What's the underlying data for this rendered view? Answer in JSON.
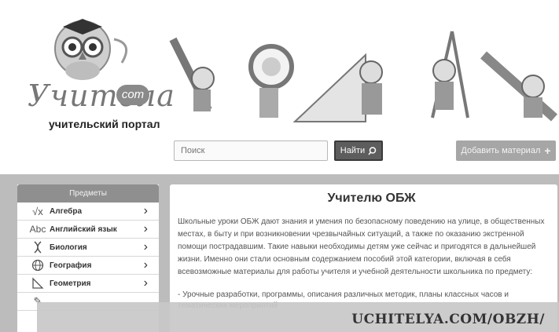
{
  "logo": {
    "name": "Учитела",
    "com": "com",
    "subtitle": "учительский портал"
  },
  "search": {
    "placeholder": "Поиск",
    "button_label": "Найти"
  },
  "add_material": {
    "label": "Добавить материал"
  },
  "sidebar": {
    "title": "Предметы",
    "items": [
      {
        "label": "Алгебра",
        "icon": "sqrt-icon"
      },
      {
        "label": "Английский язык",
        "icon": "abc-icon"
      },
      {
        "label": "Биология",
        "icon": "dna-icon"
      },
      {
        "label": "География",
        "icon": "globe-icon"
      },
      {
        "label": "Геометрия",
        "icon": "triangle-ruler-icon"
      }
    ]
  },
  "content": {
    "title": "Учителю ОБЖ",
    "paragraph": "Школьные уроки ОБЖ дают знания и умения по безопасному поведению на улице, в общественных местах, в быту и при возникновении чрезвычайных ситуаций, а также по оказанию экстренной помощи пострадавшим. Такие навыки необходимы детям уже сейчас и пригодятся в дальнейшей жизни. Именно они стали основным содержанием пособий этой категории, включая в себя всевозможные материалы для работы учителя и учебной деятельности школьника по предмету:",
    "list_item": "- Урочные разработки, программы, описания различных методик, планы классных часов и тематических мероприятий"
  },
  "caption": {
    "text": "UCHITELYA.COM/OBZH/"
  },
  "colors": {
    "band": "#bcbcbc",
    "sidebar_head": "#8f8f8f",
    "search_button": "#5d5d5d",
    "add_button": "#a6a6a6"
  }
}
